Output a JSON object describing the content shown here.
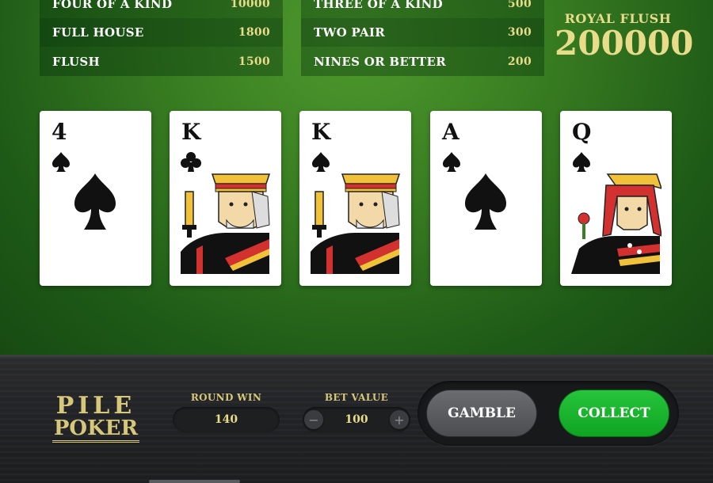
{
  "paytable": {
    "left": [
      {
        "hand": "FOUR OF A KIND",
        "value": "10000"
      },
      {
        "hand": "FULL HOUSE",
        "value": "1800"
      },
      {
        "hand": "FLUSH",
        "value": "1500"
      }
    ],
    "right": [
      {
        "hand": "THREE OF A KIND",
        "value": "500"
      },
      {
        "hand": "TWO PAIR",
        "value": "300"
      },
      {
        "hand": "NINES OR BETTER",
        "value": "200"
      }
    ]
  },
  "royal_flush": {
    "label": "ROYAL FLUSH",
    "amount": "200000"
  },
  "cards": [
    {
      "rank": "4",
      "suit": "spade"
    },
    {
      "rank": "K",
      "suit": "club"
    },
    {
      "rank": "K",
      "suit": "spade"
    },
    {
      "rank": "A",
      "suit": "spade"
    },
    {
      "rank": "Q",
      "suit": "spade"
    }
  ],
  "logo": {
    "line1": "PILE",
    "line2": "POKER"
  },
  "round_win": {
    "label": "ROUND WIN",
    "value": "140"
  },
  "bet_value": {
    "label": "BET VALUE",
    "value": "100",
    "minus": "−",
    "plus": "+"
  },
  "buttons": {
    "gamble": "GAMBLE",
    "collect": "COLLECT"
  },
  "colors": {
    "gold": "#e8dc8a",
    "collect_green": "#1bb830",
    "felt_green": "#3a7f22"
  }
}
